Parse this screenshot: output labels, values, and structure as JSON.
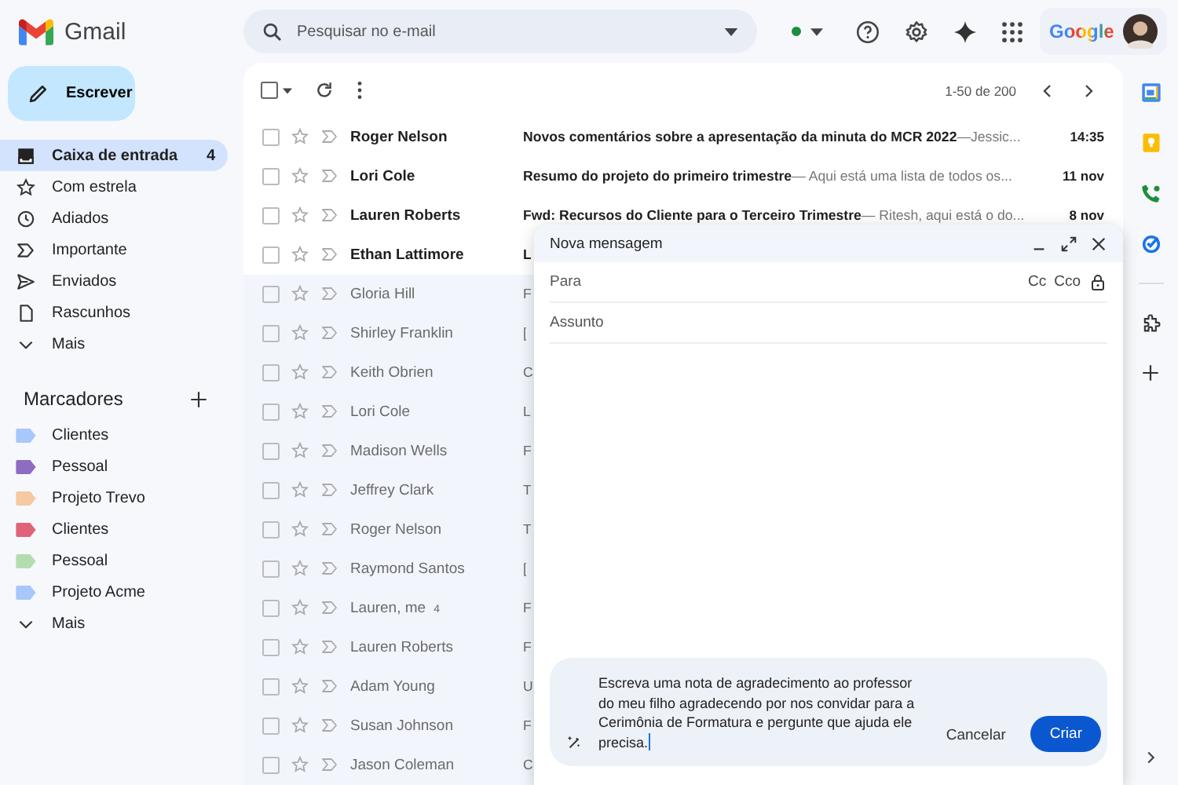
{
  "app": {
    "name": "Gmail"
  },
  "search": {
    "placeholder": "Pesquisar no e-mail"
  },
  "header": {
    "account_brand": "Google"
  },
  "compose_button": {
    "label": "Escrever"
  },
  "nav": [
    {
      "kind": "inbox",
      "label": "Caixa de entrada",
      "count": "4",
      "selected": true
    },
    {
      "kind": "star",
      "label": "Com estrela",
      "selected": false
    },
    {
      "kind": "clock",
      "label": "Adiados",
      "selected": false
    },
    {
      "kind": "important",
      "label": "Importante",
      "selected": false
    },
    {
      "kind": "send",
      "label": "Enviados",
      "selected": false
    },
    {
      "kind": "draft",
      "label": "Rascunhos",
      "selected": false
    },
    {
      "kind": "more",
      "label": "Mais",
      "selected": false
    }
  ],
  "labels": {
    "title": "Marcadores",
    "items": [
      {
        "label": "Clientes",
        "color": "#a8c7fa"
      },
      {
        "label": "Pessoal",
        "color": "#8e6cc1"
      },
      {
        "label": "Projeto Trevo",
        "color": "#f6c9a0"
      },
      {
        "label": "Clientes",
        "color": "#e0637a"
      },
      {
        "label": "Pessoal",
        "color": "#b5dcae"
      },
      {
        "label": "Projeto Acme",
        "color": "#a8c7fa"
      }
    ],
    "more": "Mais"
  },
  "toolbar": {
    "range": "1-50 de 200",
    "select_all_checked": false
  },
  "messages": [
    {
      "sender": "Roger Nelson",
      "subject": "Novos comentários sobre a apresentação da minuta do MCR 2022",
      "snippet": "—Jessic...",
      "time": "14:35",
      "unread": true
    },
    {
      "sender": "Lori Cole",
      "subject": "Resumo do projeto do primeiro trimestre",
      "snippet": "— Aqui está uma lista de todos os...",
      "time": "11 nov",
      "unread": true
    },
    {
      "sender": "Lauren Roberts",
      "subject": "Fwd: Recursos do Cliente para o Terceiro Trimestre",
      "snippet": "— Ritesh, aqui está o do...",
      "time": "8 nov",
      "unread": true
    },
    {
      "sender": "Ethan Lattimore",
      "subject": "L",
      "unread": true
    },
    {
      "sender": "Gloria Hill",
      "subject": "F",
      "unread": false
    },
    {
      "sender": "Shirley Franklin",
      "subject": "[",
      "unread": false
    },
    {
      "sender": "Keith Obrien",
      "subject": "C",
      "unread": false
    },
    {
      "sender": "Lori Cole",
      "subject": "L",
      "unread": false
    },
    {
      "sender": "Madison Wells",
      "subject": "F",
      "unread": false
    },
    {
      "sender": "Jeffrey Clark",
      "subject": "T",
      "unread": false
    },
    {
      "sender": "Roger Nelson",
      "subject": "T",
      "unread": false
    },
    {
      "sender": "Raymond Santos",
      "subject": "[",
      "unread": false
    },
    {
      "sender": "Lauren, me",
      "count": "4",
      "subject": "F",
      "unread": false
    },
    {
      "sender": "Lauren Roberts",
      "subject": "F",
      "unread": false
    },
    {
      "sender": "Adam Young",
      "subject": "U",
      "unread": false
    },
    {
      "sender": "Susan Johnson",
      "subject": "F",
      "unread": false
    },
    {
      "sender": "Jason Coleman",
      "subject": "C",
      "unread": false
    }
  ],
  "compose": {
    "title": "Nova mensagem",
    "to_placeholder": "Para",
    "cc": "Cc",
    "bcc": "Cco",
    "subject_placeholder": "Assunto",
    "prompt": "Escreva uma nota de agradecimento ao professor do meu filho agradecendo por nos convidar para a Cerimônia de Formatura e pergunte que ajuda ele precisa.",
    "cancel": "Cancelar",
    "create": "Criar"
  }
}
